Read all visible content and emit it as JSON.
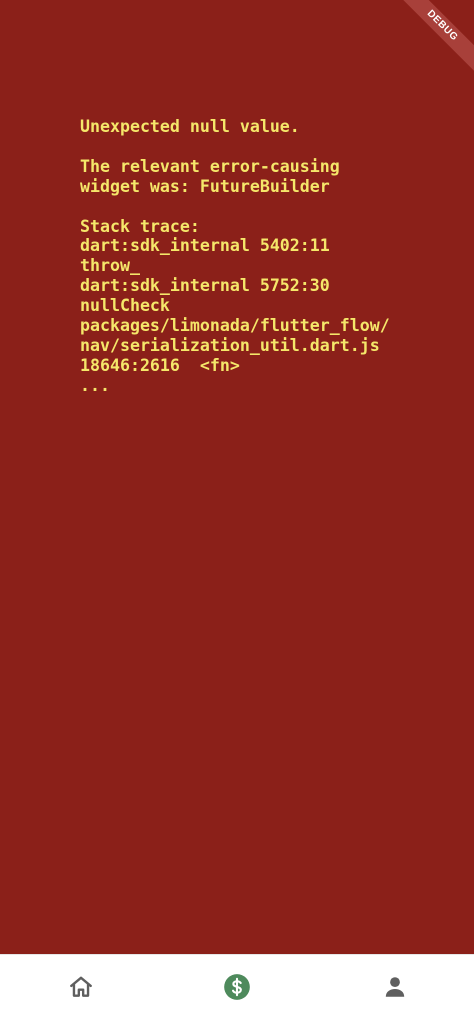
{
  "error": {
    "lines": [
      "Unexpected null value.",
      "",
      "The relevant error-causing",
      "widget was: FutureBuilder",
      "",
      "Stack trace:",
      "dart:sdk_internal 5402:11",
      "throw_",
      "dart:sdk_internal 5752:30",
      "nullCheck",
      "packages/limonada/flutter_flow/",
      "nav/serialization_util.dart.js",
      "18646:2616  <fn>",
      "..."
    ]
  },
  "debug_banner": {
    "label": "DEBUG"
  },
  "bottom_nav": {
    "items": [
      {
        "icon": "home-icon"
      },
      {
        "icon": "dollar-circle-icon",
        "active_color": "#4e8a5c"
      },
      {
        "icon": "person-icon"
      }
    ]
  },
  "colors": {
    "error_background": "#8b2019",
    "error_text": "#f5e76a",
    "nav_icon": "#5f5f5f"
  }
}
